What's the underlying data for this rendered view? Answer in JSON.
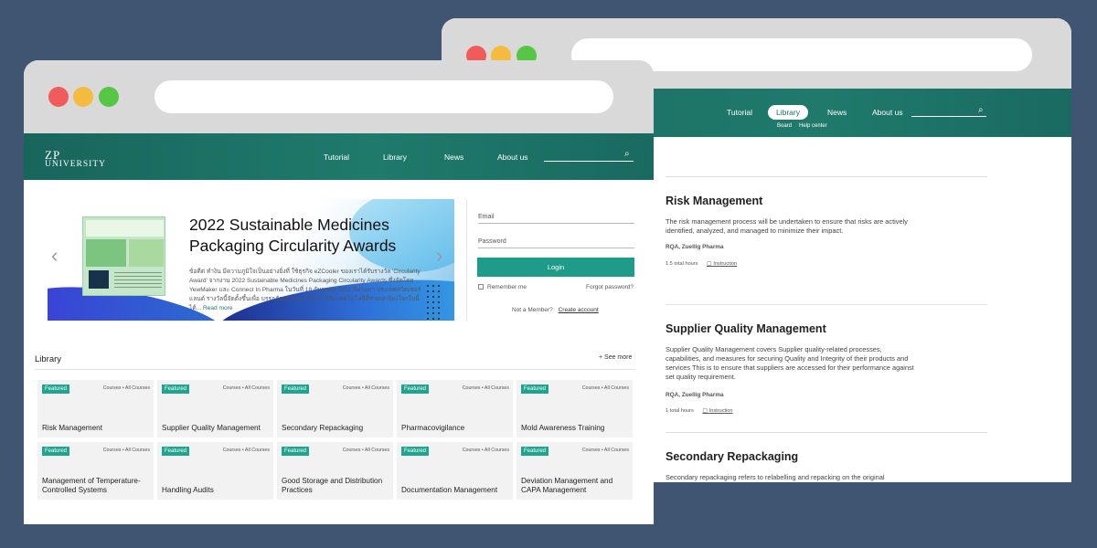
{
  "back_window": {
    "nav": [
      "Tutorial",
      "Library",
      "News",
      "About us"
    ],
    "subnav": [
      "Board",
      "Help center"
    ],
    "courses": [
      {
        "title": "Risk Management",
        "desc": "The risk management process will be undertaken to ensure that risks are actively identified, analyzed, and managed to minimize their impact.",
        "by": "RQA, Zuellig Pharma",
        "hours": "1.5 total hours",
        "inst": "Instruction"
      },
      {
        "title": "Supplier Quality Management",
        "desc": "Supplier Quality Management covers Supplier quality-related processes, capabilities, and measures for securing Quality and Integrity of their products and services This is to ensure that suppliers are accessed for their performance against set quality requirement.",
        "by": "RQA, Zuellig Pharma",
        "hours": "1 total hours",
        "inst": "Instruction"
      },
      {
        "title": "Secondary Repackaging",
        "desc": "Secondary repackaging refers to relabelling and repacking on the original"
      }
    ]
  },
  "front_window": {
    "logo_line1": "ZP",
    "logo_line2": "UNIVERSITY",
    "nav": [
      "Tutorial",
      "Library",
      "News",
      "About us"
    ],
    "banner": {
      "title": "2022 Sustainable Medicines Packaging Circularity Awards",
      "body": "ข้อดีต่ ทำงิน มีความภูมิใจเป็นอย่างยิ่งที่ ใช้ธุรกิจ eZCooler ของเราได้รับรางวัล 'Circularity Award' จากงาน 2022 Sustainable Medicines Packaging Circularity Awards ซึ่งจัดโดย YewMaker และ Connect In Pharma ในวันที่ 18 กันยายน 2022 ที่ผ่านมา ประเทศสวิตเซอร์แลนด์ รางวัลนี้จัดตั้งขึ้นเพื่อ บรรจุภัณฑ์ กระบวนการ หรือ เทคโนโลยีที่ช่วยปกป้องโลกใบนี้ได้...",
      "read_more": "Read more"
    },
    "login": {
      "email": "Email",
      "password": "Password",
      "button": "Login",
      "remember": "Remember me",
      "forgot": "Forgot password?",
      "not_member": "Not a Member?",
      "create": "Create account"
    },
    "library": {
      "title": "Library",
      "see_more": "+ See more",
      "badge": "Featured",
      "type": "Courses • All Courses",
      "cards": [
        "Risk Management",
        "Supplier Quality Management",
        "Secondary Repackaging",
        "Pharmacovigilance",
        "Mold Awareness Training",
        "Management of Temperature-Controlled Systems",
        "Handling Audits",
        "Good Storage and Distribution Practices",
        "Documentation Management",
        "Deviation Management and CAPA Management"
      ]
    }
  }
}
